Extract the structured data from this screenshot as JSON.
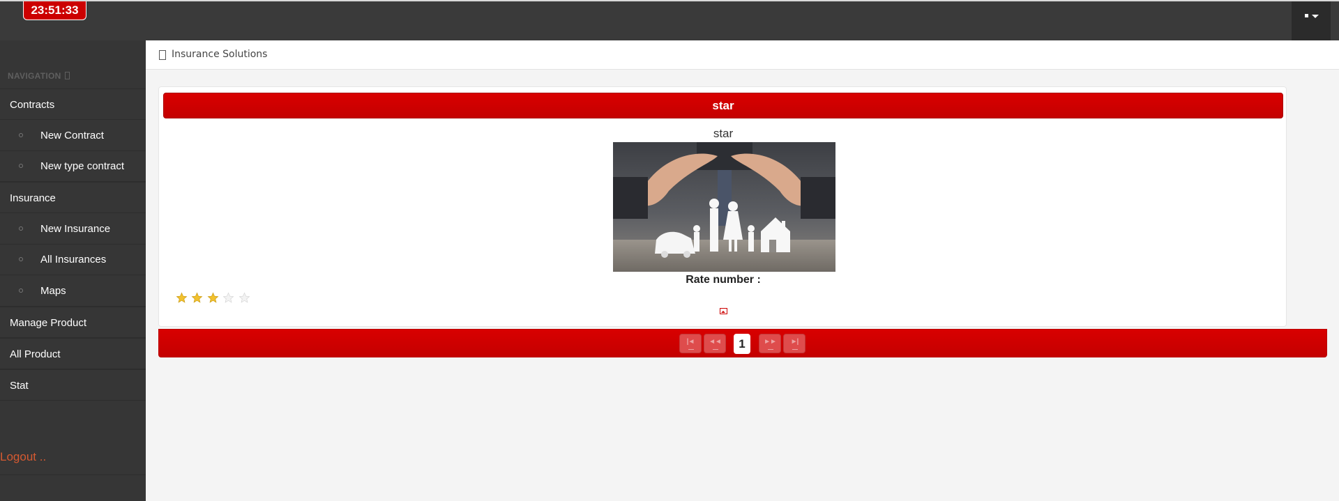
{
  "header": {
    "clock": "23:51:33"
  },
  "sidebar": {
    "title": "NAVIGATION",
    "items": [
      {
        "label": "Contracts",
        "level": "top"
      },
      {
        "label": "New Contract",
        "level": "sub"
      },
      {
        "label": "New type contract",
        "level": "sub"
      },
      {
        "label": "Insurance",
        "level": "top"
      },
      {
        "label": "New Insurance",
        "level": "sub"
      },
      {
        "label": "All Insurances",
        "level": "sub"
      },
      {
        "label": "Maps",
        "level": "sub"
      },
      {
        "label": "Manage Product",
        "level": "top"
      },
      {
        "label": "All Product",
        "level": "top"
      },
      {
        "label": "Stat",
        "level": "top"
      }
    ],
    "logout": "Logout .."
  },
  "breadcrumb": {
    "text": "Insurance Solutions"
  },
  "panel": {
    "header": "star",
    "item_title": "star",
    "rate_label": "Rate number :",
    "rating": 3,
    "rating_max": 5
  },
  "paginator": {
    "current_page": "1"
  },
  "colors": {
    "accent": "#cc0000",
    "topbar": "#3a3a3a",
    "sidebar": "#363636",
    "logout": "#d65a31",
    "background": "#f4f4f4"
  }
}
